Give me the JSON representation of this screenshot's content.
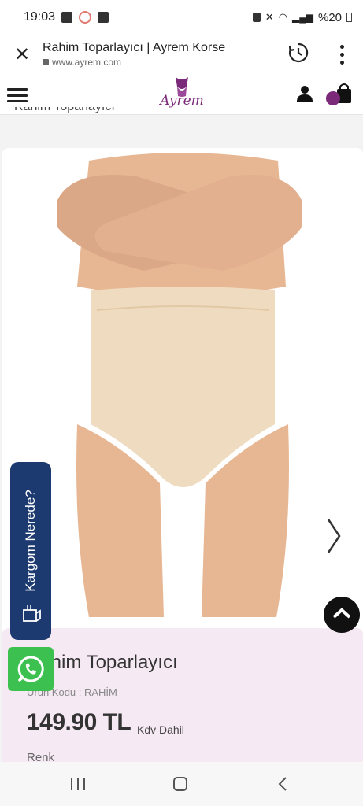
{
  "status_bar": {
    "time": "19:03",
    "battery": "%20"
  },
  "browser": {
    "page_title": "Rahim Toparlayıcı | Ayrem Korse",
    "url": "www.ayrem.com"
  },
  "site": {
    "logo_text": "Ayrem",
    "breadcrumb": "Rahim Toparlayıcı",
    "brand_color": "#7a2a79"
  },
  "product": {
    "name": "Rahim Toparlayıcı",
    "code": "Ürün Kodu : RAHİM",
    "price": "149.90 TL",
    "tax_note": "Kdv Dahil",
    "color_label": "Renk"
  },
  "floating": {
    "cargo_label": "Kargom Nerede?",
    "cargo_color": "#1c3a6f",
    "whatsapp_color": "#3cc04f"
  },
  "icons": {
    "close": "close-icon",
    "history": "history-icon",
    "menu": "more-vert-icon",
    "hamburger": "hamburger-menu-icon",
    "user": "user-icon",
    "cart": "shopping-bag-icon",
    "next": "chevron-right-icon",
    "scroll_top": "chevron-up-icon",
    "whatsapp": "whatsapp-icon",
    "cargo": "package-icon"
  }
}
